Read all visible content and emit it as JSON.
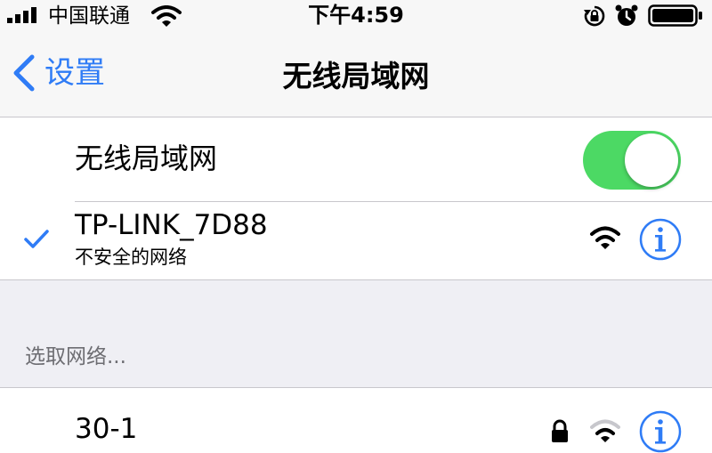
{
  "status_bar": {
    "carrier": "中国联通",
    "time": "下午4:59",
    "icons": [
      "signal-bars-icon",
      "wifi-icon",
      "rotation-lock-icon",
      "alarm-icon",
      "battery-icon"
    ]
  },
  "nav_bar": {
    "back_label": "设置",
    "title": "无线局域网"
  },
  "wifi_toggle": {
    "label": "无线局域网",
    "on": true
  },
  "connected_network": {
    "name": "TP-LINK_7D88",
    "subtitle": "不安全的网络",
    "selected": true,
    "signal": "strong"
  },
  "choose_network": {
    "header": "选取网络...",
    "networks": [
      {
        "name": "30-1",
        "locked": true,
        "signal": "medium"
      }
    ]
  },
  "colors": {
    "accent": "#2f7cf6",
    "toggle_on": "#4cd964",
    "background": "#efeff4",
    "separator": "#c8c7cc",
    "section_header": "#6d6d72"
  }
}
